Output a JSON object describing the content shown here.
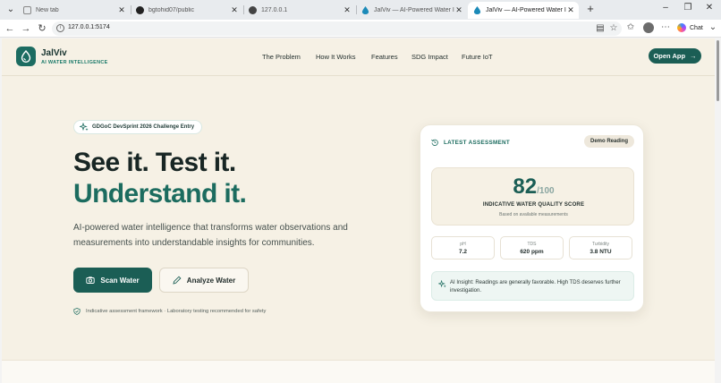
{
  "browser": {
    "tabs": [
      {
        "label": "New tab",
        "active": false
      },
      {
        "label": "bgtohid07/public",
        "active": false
      },
      {
        "label": "127.0.0.1",
        "active": false
      },
      {
        "label": "JalViv — AI-Powered Water Intellig",
        "active": false
      },
      {
        "label": "JalViv — AI-Powered Water Intellig",
        "active": true
      }
    ],
    "url": "127.0.0.1:5174",
    "chat_label": "Chat"
  },
  "site": {
    "brand_name": "JalViv",
    "brand_tagline": "AI WATER INTELLIGENCE",
    "nav": [
      "The Problem",
      "How It Works",
      "Features",
      "SDG Impact",
      "Future IoT"
    ],
    "cta": "Open App"
  },
  "hero": {
    "badge": "GDGoC DevSprint 2026 Challenge Entry",
    "line1": "See it. Test it.",
    "line2": "Understand it.",
    "description": "AI-powered water intelligence that transforms water observations and measurements into understandable insights for communities.",
    "primary_button": "Scan Water",
    "secondary_button": "Analyze Water",
    "disclaimer": "Indicative assessment framework · Laboratory testing recommended for safety"
  },
  "assessment": {
    "title": "LATEST ASSESSMENT",
    "badge": "Demo Reading",
    "score": "82",
    "score_max": "/100",
    "score_label": "INDICATIVE WATER QUALITY SCORE",
    "score_sub": "Based on available measurements",
    "metrics": [
      {
        "label": "pH",
        "value": "7.2"
      },
      {
        "label": "TDS",
        "value": "620 ppm"
      },
      {
        "label": "Turbidity",
        "value": "3.8 NTU"
      }
    ],
    "insight": "AI Insight: Readings are generally favorable. High TDS deserves further investigation."
  },
  "colors": {
    "brand_primary": "#1b5e55",
    "brand_accent": "#1c6c5f",
    "page_background": "#f6f1e5"
  }
}
